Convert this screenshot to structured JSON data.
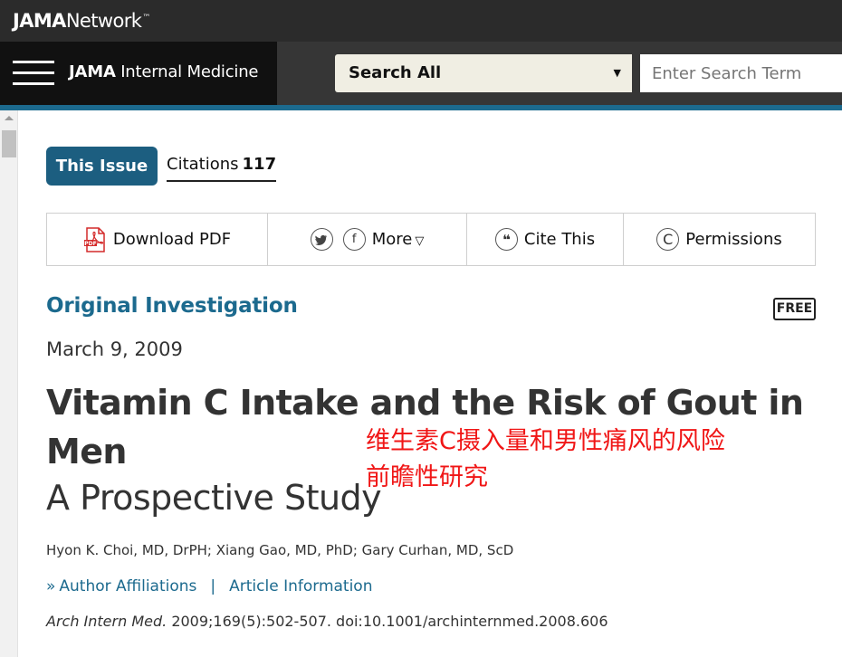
{
  "network": {
    "logo_bold": "JAMA",
    "logo_light": "Network",
    "logo_tm": "™"
  },
  "journal": {
    "name_bold": "JAMA",
    "name_light": "Internal Medicine"
  },
  "search": {
    "scope_label": "Search All",
    "placeholder": "Enter Search Term"
  },
  "tabs": {
    "this_issue": "This Issue",
    "citations_label": "Citations",
    "citations_count": "117"
  },
  "toolbar": {
    "download_pdf": "Download PDF",
    "more": "More",
    "cite_this": "Cite This",
    "permissions": "Permissions"
  },
  "article": {
    "type": "Original Investigation",
    "free_badge": "FREE",
    "date": "March 9, 2009",
    "title": "Vitamin C Intake and the Risk of Gout in Men",
    "subtitle": "A Prospective Study",
    "authors": "Hyon K. Choi, MD, DrPH; Xiang Gao, MD, PhD; Gary Curhan, MD, ScD",
    "author_affiliations": "Author Affiliations",
    "article_information": "Article Information",
    "separator": "|",
    "citation_journal": "Arch Intern Med.",
    "citation_rest": "2009;169(5):502-507. doi:10.1001/archinternmed.2008.606"
  },
  "annotation": {
    "line1": "维生素C摄入量和男性痛风的风险",
    "line2": "前瞻性研究"
  },
  "colors": {
    "accent_blue": "#1c6a8e",
    "tab_active": "#1c5e80",
    "annotation_red": "#f01616"
  }
}
